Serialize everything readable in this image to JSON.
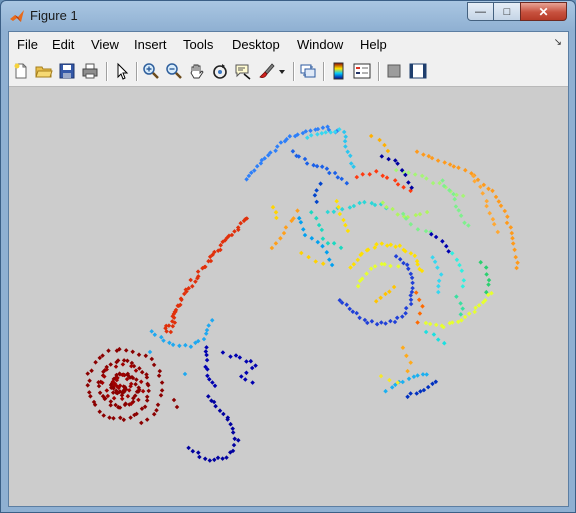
{
  "window": {
    "title": "Figure 1"
  },
  "controls": {
    "minimize": "—",
    "maximize": "□",
    "close": "✕"
  },
  "menu": [
    "File",
    "Edit",
    "View",
    "Insert",
    "Tools",
    "Desktop",
    "Window",
    "Help"
  ],
  "toolbar_icons": [
    "new-figure-icon",
    "open-file-icon",
    "save-icon",
    "print-icon",
    "edit-plot-arrow-icon",
    "zoom-in-icon",
    "zoom-out-icon",
    "pan-hand-icon",
    "rotate-3d-icon",
    "data-cursor-icon",
    "brush-icon",
    "brush-dropdown-icon",
    "link-plot-icon",
    "colorbar-icon",
    "legend-icon",
    "hide-plot-tools-icon",
    "show-plot-tools-icon"
  ],
  "colors": {
    "background": "#cccccc",
    "menu_bg": "#f0f0f0",
    "colormap": "jet"
  }
}
